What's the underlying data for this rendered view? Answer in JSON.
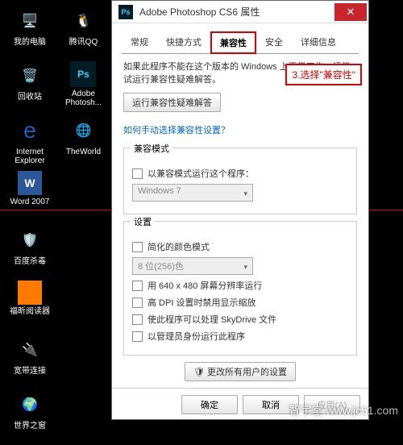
{
  "desktop": [
    {
      "name": "我的电脑"
    },
    {
      "name": "腾讯QQ"
    },
    {
      "name": "回收站"
    },
    {
      "name": "Adobe Photosh..."
    },
    {
      "name": "Internet Explorer"
    },
    {
      "name": "TheWorld"
    },
    {
      "name": "Word 2007"
    },
    {
      "name": ""
    },
    {
      "name": "百度杀毒"
    },
    {
      "name": ""
    },
    {
      "name": "福昕阅读器"
    },
    {
      "name": ""
    },
    {
      "name": "宽带连接"
    },
    {
      "name": ""
    },
    {
      "name": "世界之窗"
    },
    {
      "name": ""
    }
  ],
  "dialog": {
    "title": "Adobe Photoshop CS6 属性",
    "tabs": [
      "常规",
      "快捷方式",
      "兼容性",
      "安全",
      "详细信息"
    ],
    "active_tab": 2,
    "intro": "如果此程序不能在这个版本的 Windows 上正常工作，请尝试运行兼容性疑难解答。",
    "troubleshoot_btn": "运行兼容性疑难解答",
    "manual_link": "如何手动选择兼容性设置？",
    "callout": "3.选择\"兼容性\"",
    "compat_group": {
      "title": "兼容模式",
      "cb": "以兼容模式运行这个程序：",
      "select": "Windows 7"
    },
    "settings_group": {
      "title": "设置",
      "cb_color": "简化的颜色模式",
      "color_select": "8 位(256)色",
      "cb_640": "用 640 x 480 屏幕分辨率运行",
      "cb_dpi": "高 DPI 设置时禁用显示缩放",
      "cb_sky": "使此程序可以处理 SkyDrive 文件",
      "cb_admin": "以管理员身份运行此程序"
    },
    "all_users_btn": "更改所有用户的设置",
    "footer": {
      "ok": "确定",
      "cancel": "取消",
      "apply": "应用(A)"
    }
  },
  "watermark": "智宇堂 www.jc51.com"
}
